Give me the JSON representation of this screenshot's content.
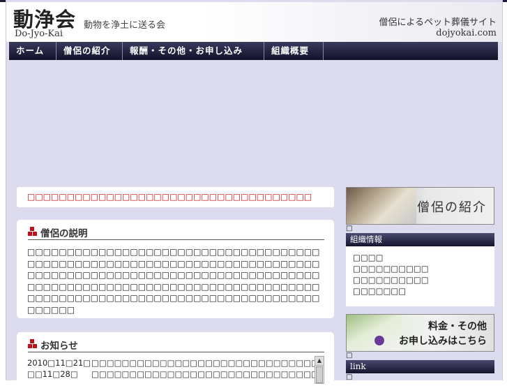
{
  "header": {
    "logo_kanji": "動浄会",
    "logo_romaji": "Do-Jyo-Kai",
    "tagline": "動物を浄土に送る会",
    "site_title": "僧侶によるペット葬儀サイト",
    "domain": "dojyokai.com"
  },
  "nav": {
    "items": [
      {
        "label": "ホーム"
      },
      {
        "label": "僧侶の紹介"
      },
      {
        "label": "報酬・その他・お申し込み"
      },
      {
        "label": "組織概要"
      }
    ]
  },
  "main": {
    "alert_text": "□□□□□□□□□□□□□□□□□□□□□□□□□□□□□□□□□□□□",
    "description": {
      "heading": "僧侶の説明",
      "body": "□□□□□□□□□□□□□□□□□□□□□□□□□□□□□□□□□□□□□□□□□□□□□□□□□□□□□□□□□□□□□□□□□□□□□□□□□□□□□□□□□□□□□□□□□□□□□□□□□□□□□□□□□□□□□□□□□□□□□□□□□□□□□□□□□□□□□□□□□□□□□□□□□□□□□□□□□□□□□□□□□□□□□□□□□□□□□□□□□□□□□□□□□□□□□□□"
    },
    "news": {
      "heading": "お知らせ",
      "items": [
        {
          "date": "2010□11□21□",
          "text": "□□□□□□□□□□□□□□□□□□□□□□□□□□□□□□□"
        },
        {
          "date": "□□11□28□",
          "text": "□□□□□□□□□□□□□□□□□□□□□□□□□□□□□□□□□□□□□□□□□□□"
        }
      ]
    }
  },
  "sidebar": {
    "banner_monks": "僧侶の紹介",
    "glyph": "□",
    "org_heading": "組織情報",
    "org_items": [
      {
        "label": "□□□□"
      },
      {
        "label": "□□□□□□□□□□"
      },
      {
        "label": "□□□□□□□□□□"
      },
      {
        "label": "□□□□□□□"
      }
    ],
    "banner_fees_line1": "料金・その他",
    "banner_fees_line2": "お申し込みはこちら",
    "link_heading": "link"
  },
  "colors": {
    "background": "#dcdcee",
    "nav_bg": "#1c1c3a",
    "accent_red": "#cc0000"
  }
}
